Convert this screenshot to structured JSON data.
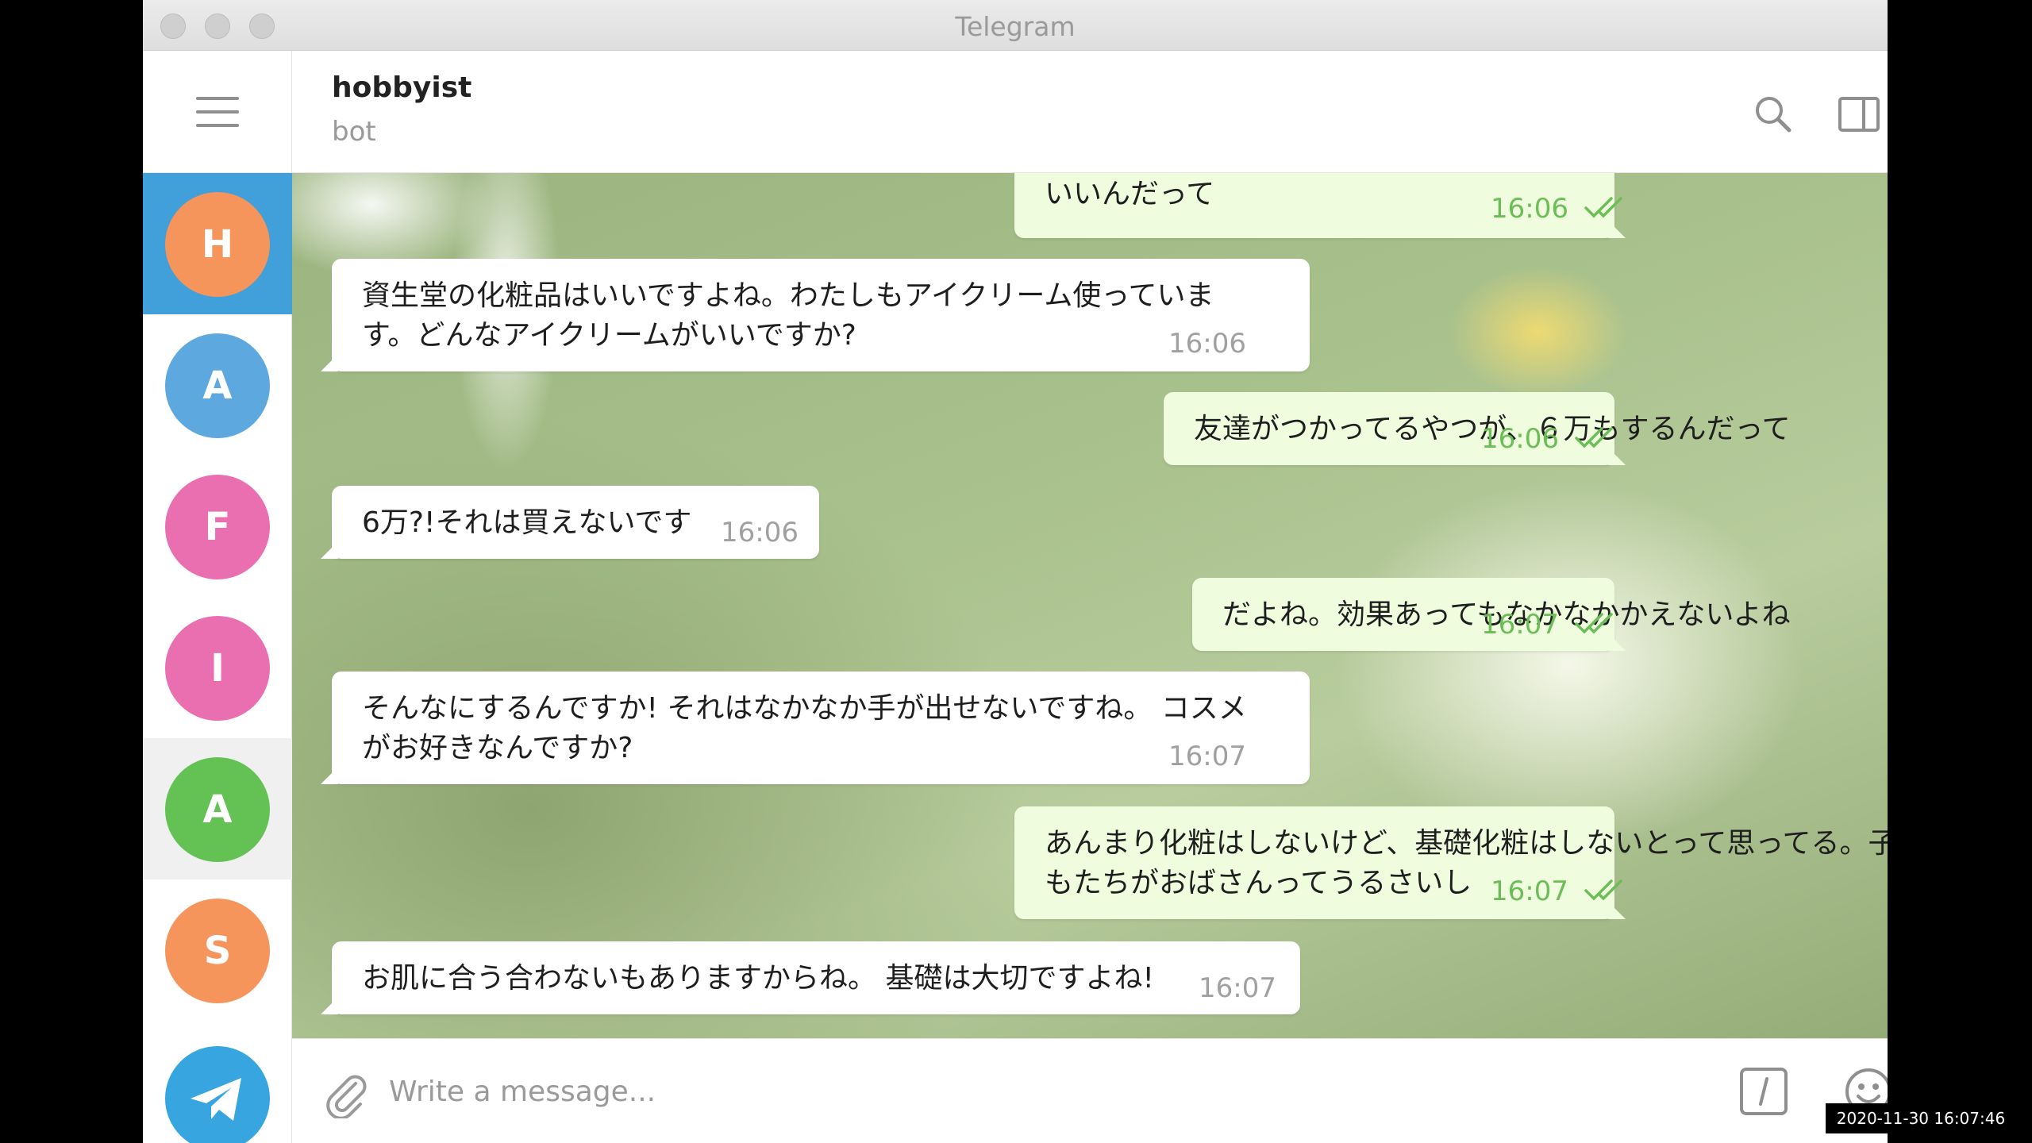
{
  "window": {
    "title": "Telegram"
  },
  "chat": {
    "name": "hobbyist",
    "status": "bot"
  },
  "dialogs": [
    {
      "initial": "H",
      "color": "#f5955c",
      "state": "active"
    },
    {
      "initial": "A",
      "color": "#5ea8e0",
      "state": ""
    },
    {
      "initial": "F",
      "color": "#ea6fb0",
      "state": ""
    },
    {
      "initial": "I",
      "color": "#ea6fb0",
      "state": ""
    },
    {
      "initial": "A",
      "color": "#64c255",
      "state": "hover"
    },
    {
      "initial": "S",
      "color": "#f5955c",
      "state": ""
    }
  ],
  "messages": [
    {
      "dir": "out",
      "lines": [
        "いいんだって"
      ],
      "time": "16:06",
      "read": true
    },
    {
      "dir": "in",
      "lines": [
        "資生堂の化粧品はいいですよね。わたしもアイクリーム使っていま",
        "す。どんなアイクリームがいいですか?"
      ],
      "time": "16:06"
    },
    {
      "dir": "out",
      "lines": [
        "友達がつかってるやつが、６万もするんだって"
      ],
      "time": "16:06",
      "read": true
    },
    {
      "dir": "in",
      "lines": [
        "6万?!それは買えないです"
      ],
      "time": "16:06"
    },
    {
      "dir": "out",
      "lines": [
        "だよね。効果あってもなかなかかえないよね"
      ],
      "time": "16:07",
      "read": true
    },
    {
      "dir": "in",
      "lines": [
        "そんなにするんですか! それはなかなか手が出せないですね。 コスメ",
        "がお好きなんですか?"
      ],
      "time": "16:07"
    },
    {
      "dir": "out",
      "lines": [
        "あんまり化粧はしないけど、基礎化粧はしないとって思ってる。子ど",
        "もたちがおばさんってうるさいし"
      ],
      "time": "16:07",
      "read": true
    },
    {
      "dir": "in",
      "lines": [
        "お肌に合う合わないもありますからね。 基礎は大切ですよね!"
      ],
      "time": "16:07"
    }
  ],
  "composer": {
    "placeholder": "Write a message..."
  },
  "icons": {
    "menu": "hamburger-icon",
    "search": "search-icon",
    "sidebar": "sidebar-toggle-icon",
    "more": "more-vertical-icon",
    "attach": "paperclip-icon",
    "command": "bot-command-icon",
    "emoji": "emoji-icon",
    "voice": "microphone-icon",
    "telegram": "telegram-plane-icon"
  },
  "colors": {
    "accent": "#419fd9",
    "outgoing_bubble": "#effdde",
    "read_tick": "#6cbd58"
  },
  "screen_timestamp": "2020-11-30 16:07:46"
}
